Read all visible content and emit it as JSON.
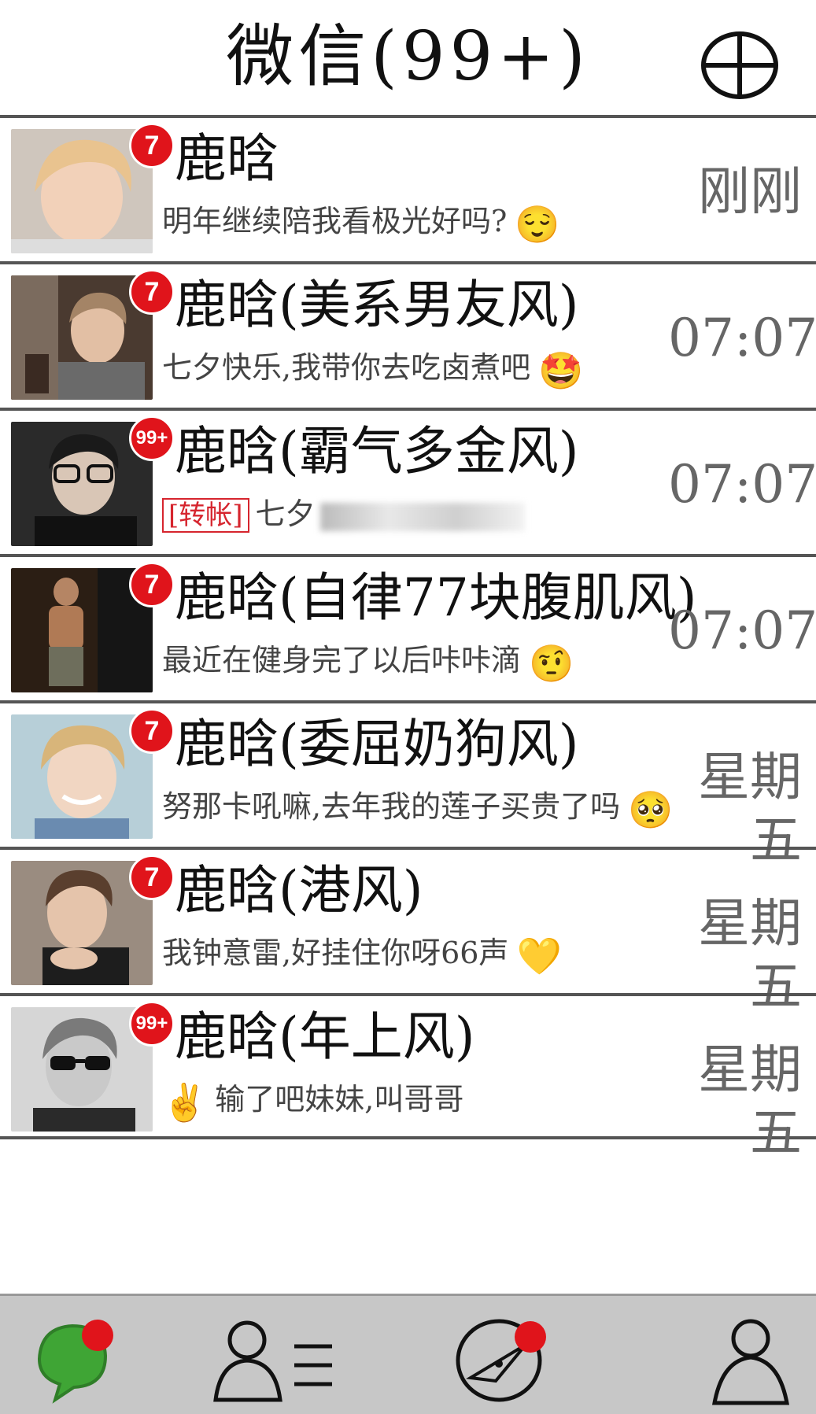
{
  "header": {
    "title": "微信(99+)",
    "add_icon": "plus-circle-icon"
  },
  "chats": [
    {
      "name": "鹿晗",
      "badge": "7",
      "preview_tag": "",
      "preview": "明年继续陪我看极光好吗?",
      "emoji": "😌",
      "time": "刚刚",
      "avatar_color": "#e9c38f"
    },
    {
      "name": "鹿晗(美系男友风)",
      "badge": "7",
      "preview_tag": "",
      "preview": "七夕快乐,我带你去吃卤煮吧",
      "emoji": "🤩",
      "time": "07:07",
      "avatar_color": "#8a6f56"
    },
    {
      "name": "鹿晗(霸气多金风)",
      "badge": "99+",
      "preview_tag": "[转帐]",
      "preview": "七夕",
      "emoji": "",
      "time": "07:07",
      "avatar_color": "#3b3b3b"
    },
    {
      "name": "鹿晗(自律77块腹肌风)",
      "badge": "7",
      "preview_tag": "",
      "preview": "最近在健身完了以后咔咔滴",
      "emoji": "🤨",
      "time": "07:07",
      "avatar_color": "#6b4a32"
    },
    {
      "name": "鹿晗(委屈奶狗风)",
      "badge": "7",
      "preview_tag": "",
      "preview": "努那卡吼嘛,去年我的莲子买贵了吗",
      "emoji": "🥺",
      "time": "星期五",
      "avatar_color": "#d8b57a"
    },
    {
      "name": "鹿晗(港风)",
      "badge": "7",
      "preview_tag": "",
      "preview": "我钟意雷,好挂住你呀66声",
      "emoji": "💛",
      "time": "星期五",
      "avatar_color": "#6d5442"
    },
    {
      "name": "鹿晗(年上风)",
      "badge": "99+",
      "preview_tag": "",
      "preview": "输了吧妹妹,叫哥哥",
      "emoji": "✌️",
      "time": "星期五",
      "avatar_color": "#8d8d8d"
    }
  ],
  "tabbar": {
    "tabs": [
      {
        "icon": "chat-bubble-icon",
        "active": true,
        "dot": true
      },
      {
        "icon": "contacts-icon",
        "active": false,
        "dot": false
      },
      {
        "icon": "discover-compass-icon",
        "active": false,
        "dot": true
      },
      {
        "icon": "me-person-icon",
        "active": false,
        "dot": false
      }
    ],
    "accent_color": "#3fa535",
    "dot_color": "#e0141b"
  }
}
